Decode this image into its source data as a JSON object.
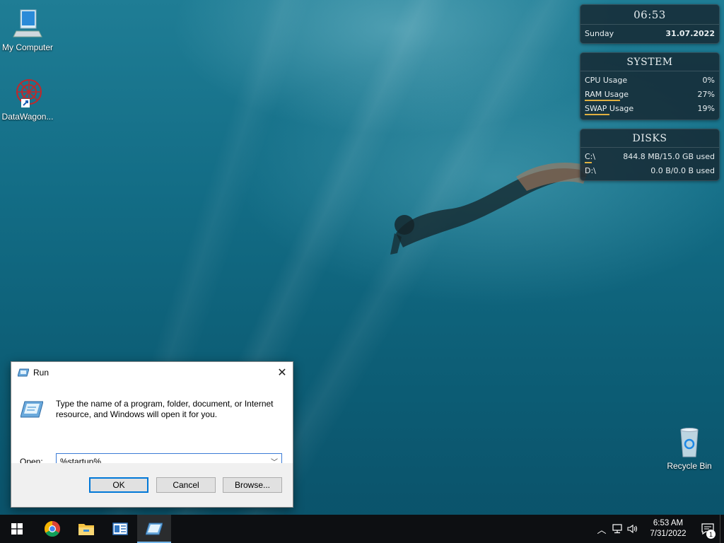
{
  "desktop": {
    "icons": [
      {
        "label": "My Computer",
        "icon": "computer-icon"
      },
      {
        "label": "DataWagon...",
        "icon": "datawagon-icon"
      },
      {
        "label": "Recycle Bin",
        "icon": "recycle-bin-icon"
      }
    ]
  },
  "widgets": {
    "clock": {
      "time": "06:53",
      "day": "Sunday",
      "date": "31.07.2022"
    },
    "system": {
      "title": "SYSTEM",
      "rows": [
        {
          "label": "CPU Usage",
          "value": "0%",
          "level": 0
        },
        {
          "label": "RAM Usage",
          "value": "27%",
          "level": 0.27
        },
        {
          "label": "SWAP Usage",
          "value": "19%",
          "level": 0.19
        }
      ]
    },
    "disks": {
      "title": "DISKS",
      "rows": [
        {
          "label": "C:\\",
          "value": "844.8 MB/15.0 GB used",
          "level": 0.055
        },
        {
          "label": "D:\\",
          "value": "0.0 B/0.0 B used",
          "level": 0
        }
      ]
    }
  },
  "run_dialog": {
    "title": "Run",
    "description": "Type the name of a program, folder, document, or Internet resource, and Windows will open it for you.",
    "open_label": "Open:",
    "input_value": "%startup%",
    "ok_label": "OK",
    "cancel_label": "Cancel",
    "browse_label": "Browse..."
  },
  "taskbar": {
    "items": [
      "start-icon",
      "chrome-icon",
      "file-explorer-icon",
      "control-panel-icon",
      "run-icon"
    ],
    "tray": {
      "time": "6:53 AM",
      "date": "7/31/2022",
      "notification_count": "1"
    }
  },
  "colors": {
    "accent": "#0078d7",
    "usage_bar": "#e0b040",
    "taskbar": "#0d0f12"
  }
}
